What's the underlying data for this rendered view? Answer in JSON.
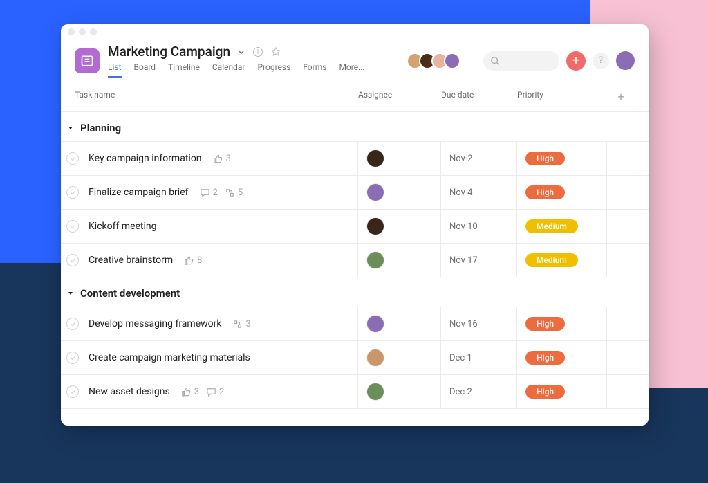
{
  "project": {
    "title": "Marketing Campaign",
    "icon": "list-board-icon"
  },
  "tabs": [
    {
      "label": "List",
      "active": true
    },
    {
      "label": "Board"
    },
    {
      "label": "Timeline"
    },
    {
      "label": "Calendar"
    },
    {
      "label": "Progress"
    },
    {
      "label": "Forms"
    },
    {
      "label": "More..."
    }
  ],
  "header_avatars": [
    {
      "bg": "#d4a373"
    },
    {
      "bg": "#4a2c1a"
    },
    {
      "bg": "#e8b4a0"
    },
    {
      "bg": "#8b6db5"
    }
  ],
  "me_avatar_bg": "#8b6db5",
  "columns": {
    "name": "Task name",
    "assignee": "Assignee",
    "due": "Due date",
    "priority": "Priority"
  },
  "sections": [
    {
      "name": "Planning",
      "tasks": [
        {
          "name": "Key campaign information",
          "likes": 3,
          "assignee_bg": "#3a2618",
          "due": "Nov 2",
          "priority": "High"
        },
        {
          "name": "Finalize campaign brief",
          "comments": 2,
          "subtasks": 5,
          "assignee_bg": "#8b6db5",
          "due": "Nov 4",
          "priority": "High"
        },
        {
          "name": "Kickoff meeting",
          "assignee_bg": "#3a2618",
          "due": "Nov 10",
          "priority": "Medium"
        },
        {
          "name": "Creative brainstorm",
          "likes": 8,
          "assignee_bg": "#6b8e5a",
          "due": "Nov 17",
          "priority": "Medium"
        }
      ]
    },
    {
      "name": "Content development",
      "tasks": [
        {
          "name": "Develop messaging framework",
          "subtasks": 3,
          "assignee_bg": "#8b6db5",
          "due": "Nov 16",
          "priority": "High"
        },
        {
          "name": "Create campaign marketing materials",
          "assignee_bg": "#c9986a",
          "due": "Dec 1",
          "priority": "High"
        },
        {
          "name": "New asset designs",
          "likes": 3,
          "comments": 2,
          "assignee_bg": "#6b8e5a",
          "due": "Dec 2",
          "priority": "High"
        }
      ]
    }
  ]
}
